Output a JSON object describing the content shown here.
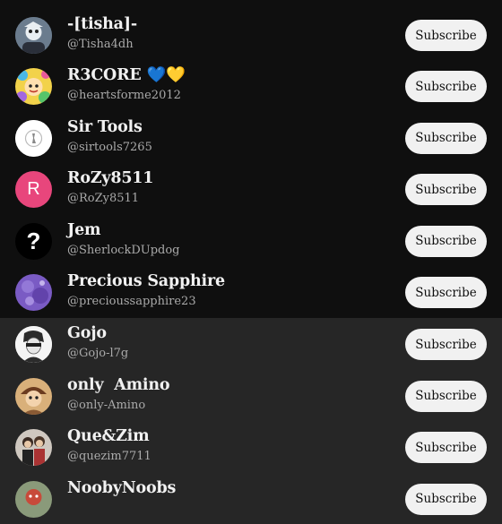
{
  "subscribe_label": "Subscribe",
  "channels": [
    {
      "name": "-[tisha]-",
      "handle": "@Tisha4dh"
    },
    {
      "name": "R3CORE 💙💛",
      "handle": "@heartsforme2012"
    },
    {
      "name": "Sir Tools",
      "handle": "@sirtools7265"
    },
    {
      "name": "RoZy8511",
      "handle": "@RoZy8511",
      "avatar_letter": "R"
    },
    {
      "name": "Jem",
      "handle": "@SherlockDUpdog",
      "avatar_glyph": "?"
    },
    {
      "name": "Precious Sapphire",
      "handle": "@precioussapphire23"
    },
    {
      "name": "Gojo",
      "handle": "@Gojo-l7g"
    },
    {
      "name": "only  Amino",
      "handle": "@only-Amino"
    },
    {
      "name": "Que&Zim",
      "handle": "@quezim7711"
    },
    {
      "name": "NoobyNoobs",
      "handle": ""
    }
  ],
  "colors": {
    "background": "#0f0f0f",
    "highlight_row": "#262626",
    "button_bg": "#f1f1f1",
    "rozy_avatar": "#e8467c"
  }
}
